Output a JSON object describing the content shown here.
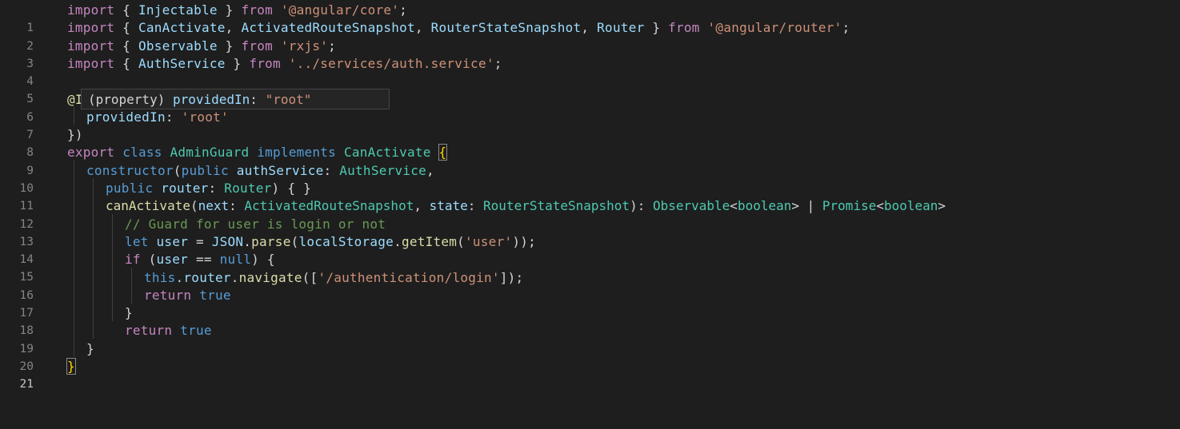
{
  "colors": {
    "background": "#1e1e1e",
    "line_number": "#858585",
    "keyword": "#c586c0",
    "storage": "#569cd6",
    "string": "#ce9178",
    "type": "#4ec9b0",
    "variable": "#9cdcfe",
    "function": "#dcdcaa",
    "comment": "#6a9955"
  },
  "line_numbers": [
    "1",
    "2",
    "3",
    "4",
    "5",
    "6",
    "7",
    "8",
    "9",
    "10",
    "11",
    "12",
    "13",
    "14",
    "15",
    "16",
    "17",
    "18",
    "19",
    "20",
    "21"
  ],
  "code": {
    "l1": [
      "import",
      " { ",
      "Injectable",
      " } ",
      "from",
      " ",
      "'@angular/core'",
      ";"
    ],
    "l2": [
      "import",
      " { ",
      "CanActivate",
      ", ",
      "ActivatedRouteSnapshot",
      ", ",
      "RouterStateSnapshot",
      ", ",
      "Router",
      " } ",
      "from",
      " ",
      "'@angular/router'",
      ";"
    ],
    "l3": [
      "import",
      " { ",
      "Observable",
      " } ",
      "from",
      " ",
      "'rxjs'",
      ";"
    ],
    "l4": [
      "import",
      " { ",
      "AuthService",
      " } ",
      "from",
      " ",
      "'../services/auth.service'",
      ";"
    ],
    "l6": [
      "@I"
    ],
    "l7": [
      "providedIn",
      ": ",
      "'root'"
    ],
    "l8": [
      "})"
    ],
    "l9": [
      "export",
      " ",
      "class",
      " ",
      "AdminGuard",
      " ",
      "implements",
      " ",
      "CanActivate",
      " ",
      "{"
    ],
    "l10": [
      "constructor",
      "(",
      "public",
      " ",
      "authService",
      ": ",
      "AuthService",
      ","
    ],
    "l11": [
      "public",
      " ",
      "router",
      ": ",
      "Router",
      ") { }"
    ],
    "l12": [
      "canActivate",
      "(",
      "next",
      ": ",
      "ActivatedRouteSnapshot",
      ", ",
      "state",
      ": ",
      "RouterStateSnapshot",
      "): ",
      "Observable",
      "<",
      "boolean",
      "> | ",
      "Promise",
      "<",
      "boolean",
      ">"
    ],
    "l13": [
      "// Guard for user is login or not"
    ],
    "l14": [
      "let",
      " ",
      "user",
      " = ",
      "JSON",
      ".",
      "parse",
      "(",
      "localStorage",
      ".",
      "getItem",
      "(",
      "'user'",
      "));"
    ],
    "l15": [
      "if",
      " (",
      "user",
      " == ",
      "null",
      ") {"
    ],
    "l16": [
      "this",
      ".",
      "router",
      ".",
      "navigate",
      "([",
      "'/authentication/login'",
      "]);"
    ],
    "l17": [
      "return",
      " ",
      "true"
    ],
    "l18": [
      "}"
    ],
    "l19": [
      "return",
      " ",
      "true"
    ],
    "l20": [
      "}"
    ],
    "l21": [
      "}"
    ]
  },
  "hover": {
    "label": "(property)",
    "name": " providedIn",
    "sep": ": ",
    "value": "\"root\""
  }
}
